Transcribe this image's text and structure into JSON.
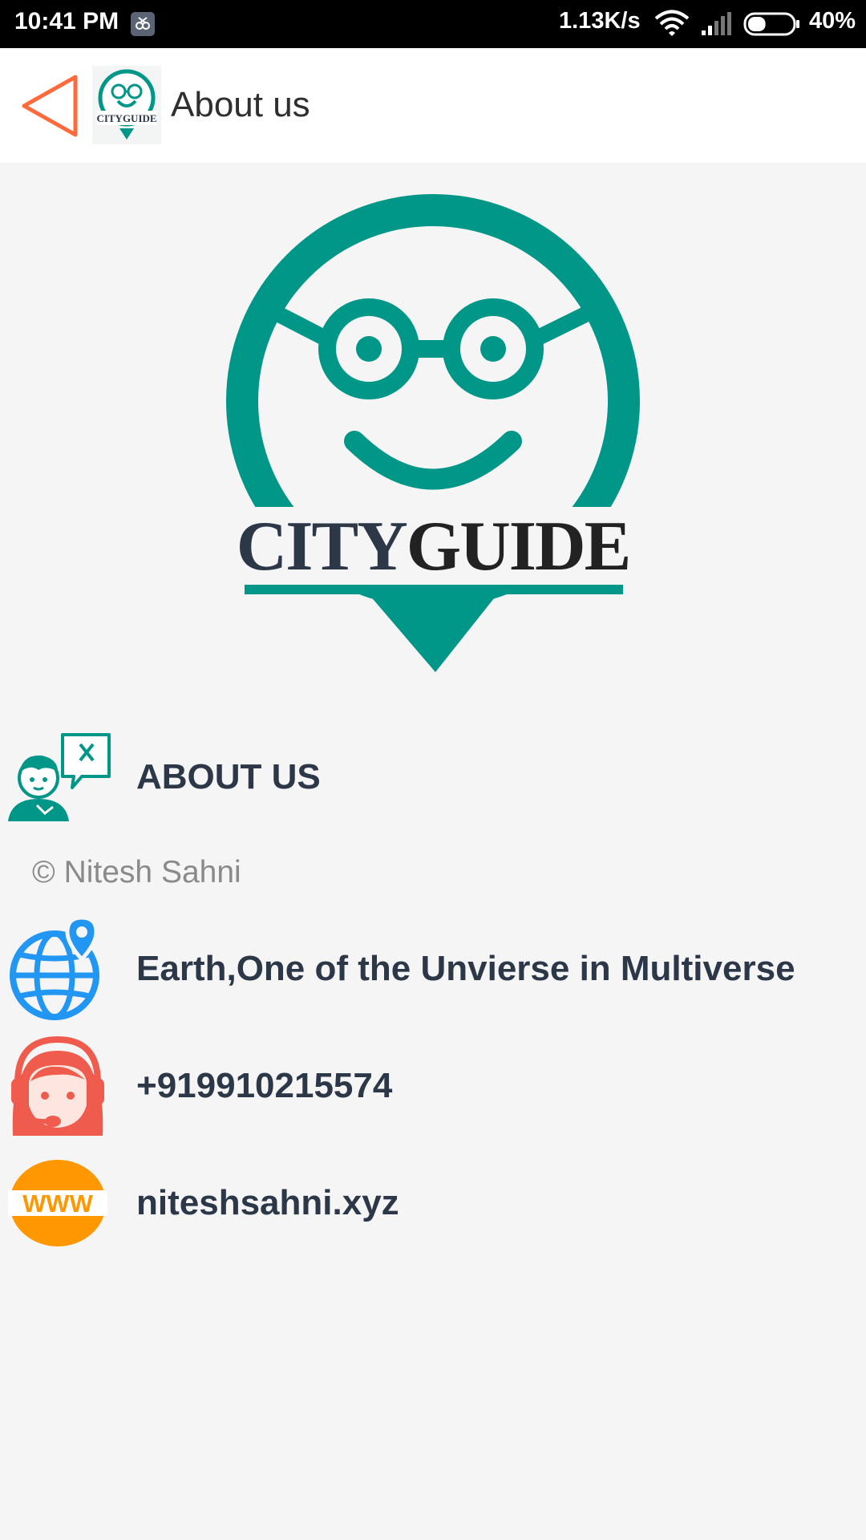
{
  "status_bar": {
    "time": "10:41 PM",
    "network_speed": "1.13K/s",
    "battery_percent": "40%",
    "battery_level": 0.4
  },
  "app_bar": {
    "title": "About us",
    "back_icon": "triangle-back-icon",
    "app_icon": "cityguide-logo-icon",
    "app_icon_text": "CITYGUIDE"
  },
  "logo": {
    "text_part1": "CITY",
    "text_part2": "GUIDE",
    "teal": "#009688",
    "navy": "#2c3848"
  },
  "about": {
    "title": "ABOUT US",
    "icon": "support-agent-chat-icon",
    "copyright": "© Nitesh Sahni"
  },
  "contact": {
    "address": "Earth,One of the Unvierse in Multiverse",
    "address_icon": "globe-location-icon",
    "phone": "+919910215574",
    "phone_icon": "headset-support-icon",
    "website": "niteshsahni.xyz",
    "website_icon": "www-icon",
    "website_icon_text": "WWW"
  },
  "colors": {
    "accent_orange": "#ff6a3d",
    "text_dark": "#2c3848",
    "globe_blue": "#2196f3",
    "support_red": "#ef5b4c",
    "www_orange": "#ff9800"
  }
}
